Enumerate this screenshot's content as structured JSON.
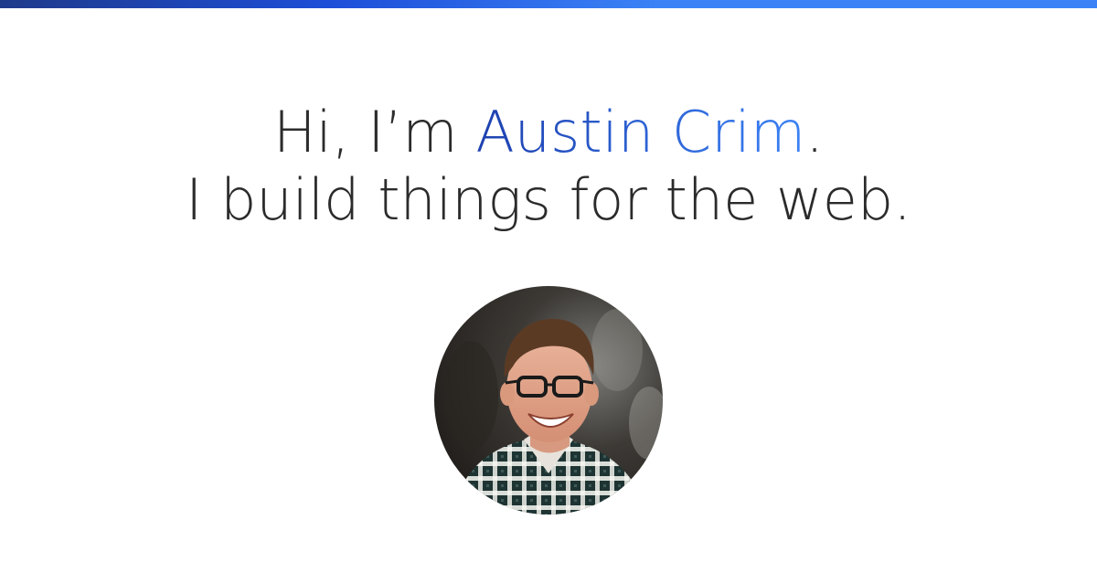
{
  "hero": {
    "greeting_prefix": "Hi, I’m ",
    "name": "Austin Crim",
    "greeting_suffix": ".",
    "tagline": "I build things for the web."
  },
  "colors": {
    "top_bar_start": "#1e3a8a",
    "top_bar_end": "#3b82f6",
    "name_start": "#1e40af",
    "name_end": "#3b82f6",
    "text": "#2b2b2b"
  },
  "avatar": {
    "icon": "profile-photo"
  }
}
